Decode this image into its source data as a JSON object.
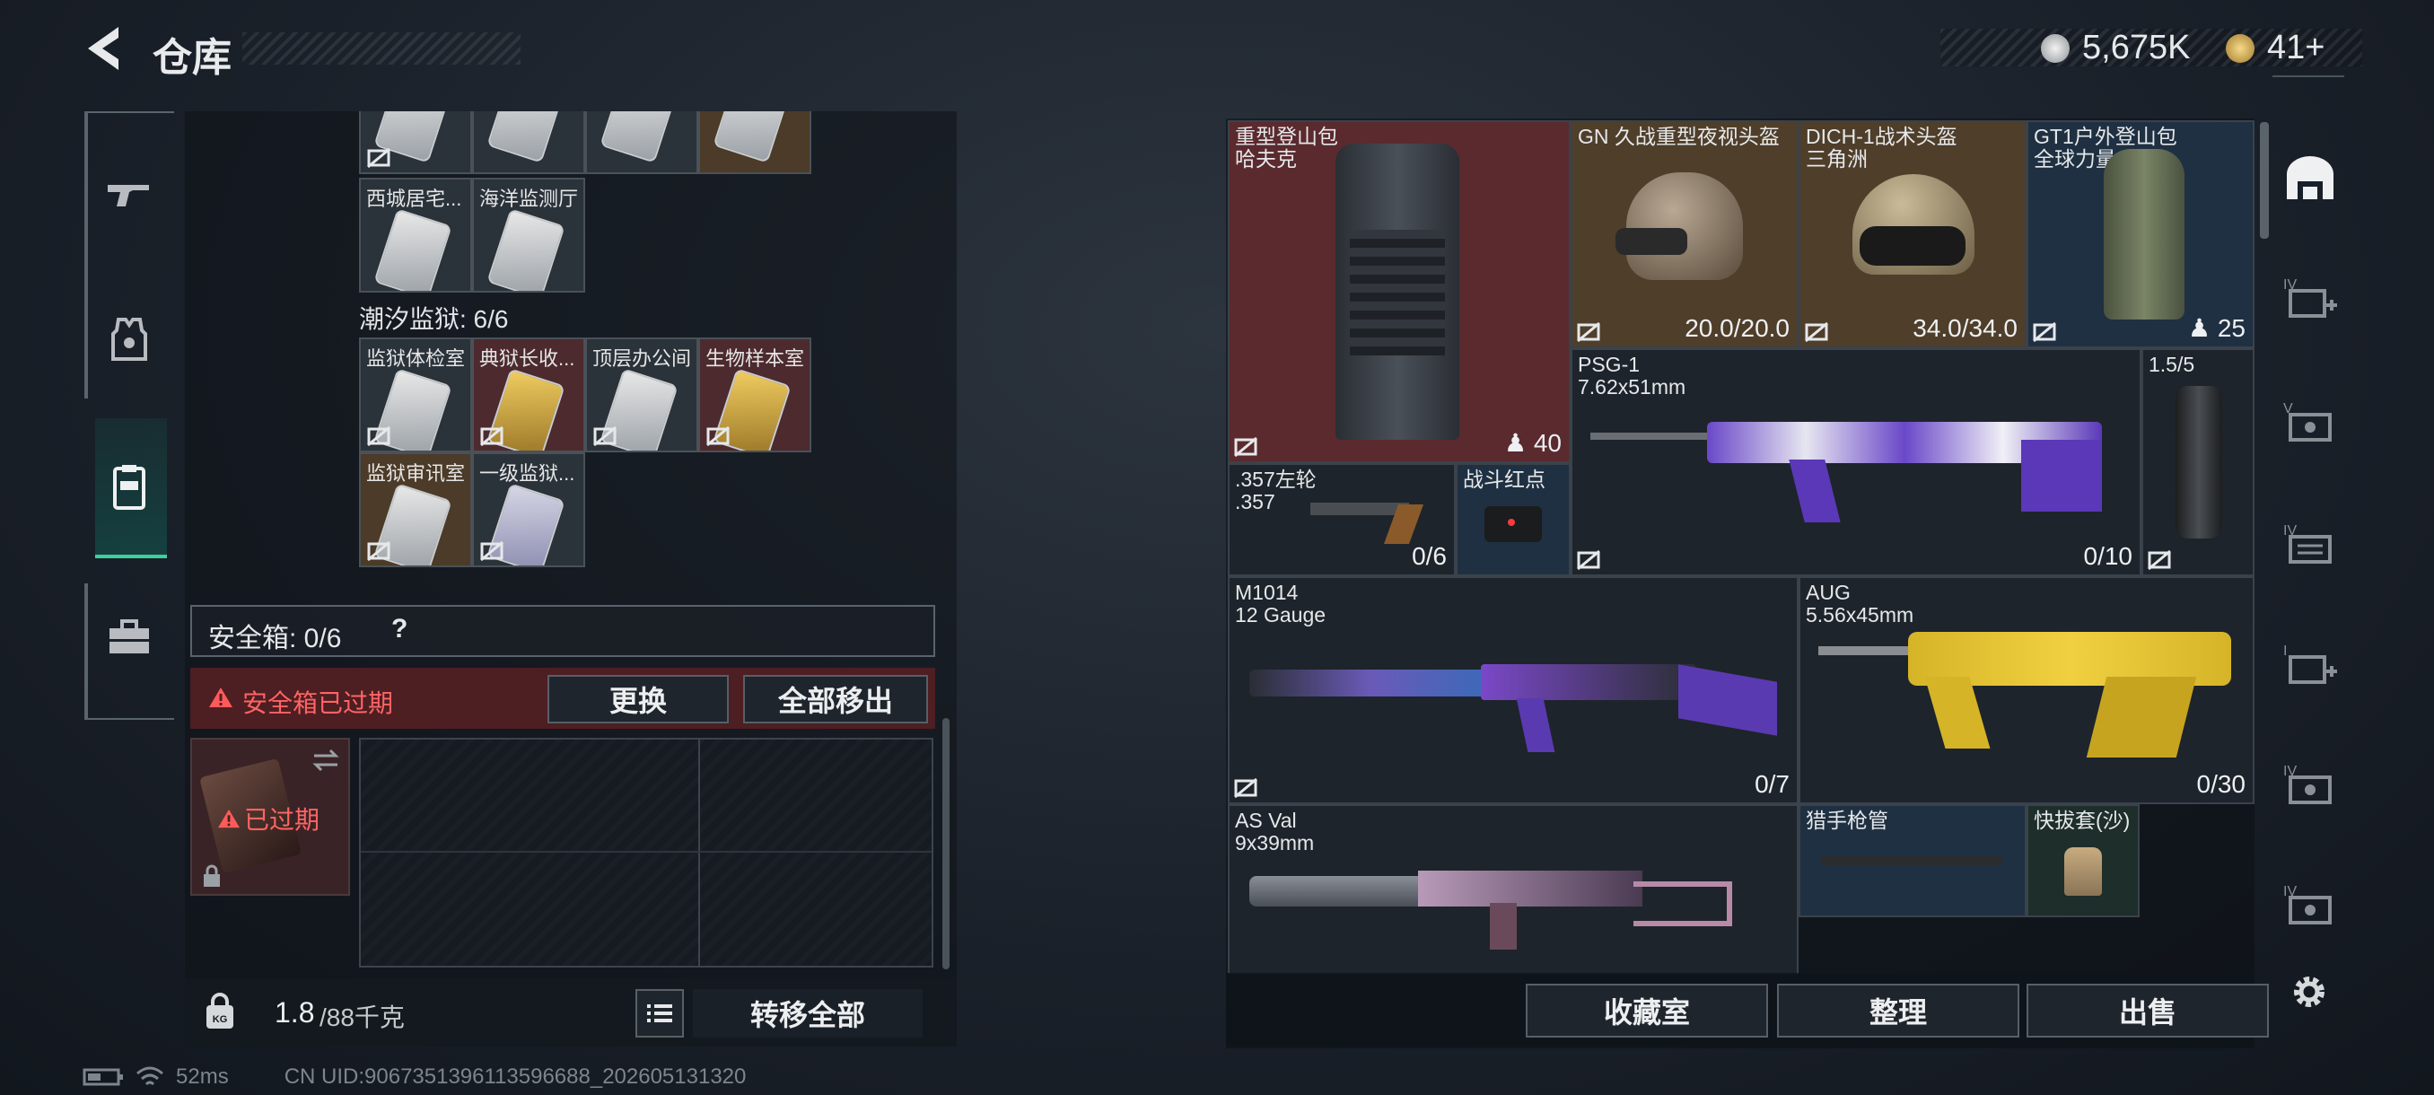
{
  "header": {
    "title": "仓库",
    "currency_1": "5,675K",
    "currency_2": "41+",
    "accent_color": "#3fcf9c"
  },
  "left_nav": {
    "items": [
      {
        "name": "weapons",
        "icon": "gun-icon"
      },
      {
        "name": "equipment",
        "icon": "vest-icon"
      },
      {
        "name": "keycards",
        "icon": "clipboard-icon",
        "active": true
      },
      {
        "name": "supplies",
        "icon": "toolbox-icon"
      }
    ]
  },
  "keycards": {
    "top_row_cards": [
      {
        "label": ""
      },
      {
        "label": ""
      },
      {
        "label": ""
      },
      {
        "label": ""
      }
    ],
    "row2": [
      {
        "label": "西城居宅..."
      },
      {
        "label": "海洋监测厅"
      }
    ],
    "prison_title": "潮汐监狱: 6/6",
    "prison_cards": [
      {
        "label": "监狱体检室",
        "style": "normal"
      },
      {
        "label": "典狱长收...",
        "style": "gold"
      },
      {
        "label": "顶层办公间",
        "style": "normal"
      },
      {
        "label": "生物样本室",
        "style": "gold"
      },
      {
        "label": "监狱审讯室",
        "style": "normal"
      },
      {
        "label": "一级监狱...",
        "style": "normal"
      }
    ]
  },
  "safe_box": {
    "label": "安全箱: 0/6",
    "help": "?",
    "warning": "安全箱已过期",
    "replace_button": "更换",
    "move_all_out_button": "全部移出",
    "expired_tag": "已过期"
  },
  "left_bottom": {
    "weight_value": "1.8",
    "weight_capacity": "/88千克",
    "transfer_all_button": "转移全部"
  },
  "inventory": [
    {
      "id": "backpack",
      "lines": "重型登山包\n哈夫克",
      "count": "40",
      "style": "red"
    },
    {
      "id": "helmet-gn",
      "lines": "GN 久战重型夜视头盔",
      "count": "20.0/20.0",
      "style": "gold"
    },
    {
      "id": "helmet-dich",
      "lines": "DICH-1战术头盔\n三角洲",
      "count": "34.0/34.0",
      "style": "gold"
    },
    {
      "id": "backpack-gt1",
      "lines": "GT1户外登山包\n全球力量",
      "count": "25",
      "style": "blue"
    },
    {
      "id": "psg1",
      "lines": "PSG-1\n7.62x51mm",
      "count": "0/10",
      "style": "normal"
    },
    {
      "id": "scope",
      "lines": "1.5/5",
      "count": "",
      "style": "normal"
    },
    {
      "id": "revolver",
      "lines": ".357左轮\n.357",
      "count": "0/6",
      "style": "normal"
    },
    {
      "id": "red-dot",
      "lines": "战斗红点",
      "count": "",
      "style": "blue"
    },
    {
      "id": "m1014",
      "lines": "M1014\n12 Gauge",
      "count": "0/7",
      "style": "normal"
    },
    {
      "id": "aug",
      "lines": "AUG\n5.56x45mm",
      "count": "0/30",
      "style": "normal"
    },
    {
      "id": "asval",
      "lines": "AS Val\n9x39mm",
      "count": "",
      "style": "normal"
    },
    {
      "id": "barrel",
      "lines": "猎手枪管",
      "count": "",
      "style": "blue"
    },
    {
      "id": "mount",
      "lines": "快拔套(沙)",
      "count": "",
      "style": "green"
    }
  ],
  "right_bottom": {
    "collection_button": "收藏室",
    "organize_button": "整理",
    "sell_button": "出售"
  },
  "side_tabs": [
    "warehouse-icon",
    "iv-add-icon",
    "v-cash-icon",
    "iv-folder-icon",
    "iv-add-icon",
    "iv-cash-icon",
    "iv-cash-icon"
  ],
  "status": {
    "ping": "52ms",
    "uid": "CN UID:9067351396113596688_202605131320"
  }
}
